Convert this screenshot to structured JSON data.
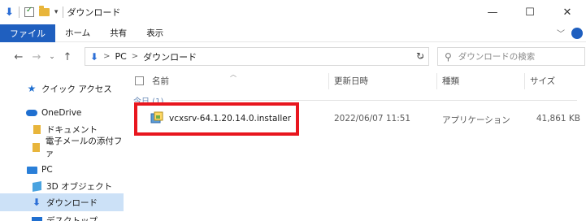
{
  "window": {
    "title": "ダウンロード",
    "minimize_glyph": "—",
    "maximize_glyph": "☐",
    "close_glyph": "✕"
  },
  "quick_access_toolbar": {
    "icons": [
      "download-arrow-icon",
      "properties-check-icon",
      "folder-icon",
      "customize-caret-icon"
    ]
  },
  "ribbon": {
    "tabs": [
      "ファイル",
      "ホーム",
      "共有",
      "表示"
    ],
    "accent": "#1f5fbf"
  },
  "address_bar": {
    "path": [
      "PC",
      "ダウンロード"
    ],
    "separator": ">",
    "search_placeholder": "ダウンロードの検索"
  },
  "nav_pane": {
    "items": [
      {
        "label": "クイック アクセス",
        "icon": "star-icon"
      },
      {
        "label": "OneDrive",
        "icon": "cloud-icon"
      },
      {
        "label": "ドキュメント",
        "icon": "folder-icon"
      },
      {
        "label": "電子メールの添付ファ",
        "icon": "folder-icon"
      },
      {
        "label": "PC",
        "icon": "pc-icon"
      },
      {
        "label": "3D オブジェクト",
        "icon": "cube-icon"
      },
      {
        "label": "ダウンロード",
        "icon": "download-arrow-icon",
        "selected": true
      },
      {
        "label": "デスクトップ",
        "icon": "desktop-icon"
      }
    ]
  },
  "file_list": {
    "columns": [
      "名前",
      "更新日時",
      "種類",
      "サイズ"
    ],
    "group_label": "今日 (1)",
    "rows": [
      {
        "name": "vcxsrv-64.1.20.14.0.installer",
        "modified": "2022/06/07 11:51",
        "type": "アプリケーション",
        "size": "41,861 KB"
      }
    ]
  },
  "highlight_color": "#e8161e"
}
